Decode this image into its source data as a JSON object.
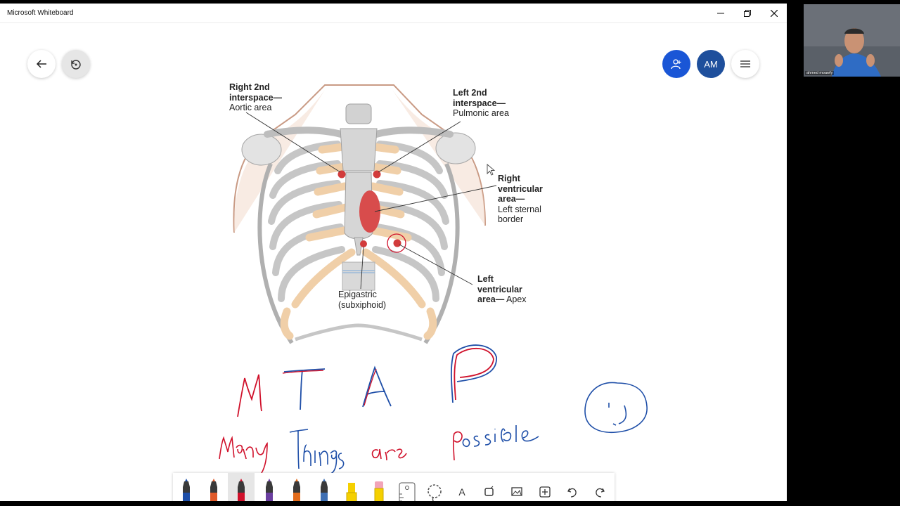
{
  "window": {
    "title": "Microsoft Whiteboard",
    "controls": [
      "minimize",
      "restore",
      "close"
    ]
  },
  "top_left_buttons": [
    {
      "icon": "back-arrow-icon"
    },
    {
      "icon": "undo-history-icon"
    }
  ],
  "top_right_buttons": {
    "invite_icon": "add-person-icon",
    "user_initials": "AM",
    "menu_icon": "hamburger-icon"
  },
  "diagram": {
    "labels": {
      "right_2nd_bold": "Right 2nd interspace—",
      "right_2nd_sub": "Aortic area",
      "left_2nd_bold": "Left 2nd interspace—",
      "left_2nd_sub": "Pulmonic area",
      "right_vent_bold": "Right ventricular area—",
      "right_vent_sub": "Left sternal border",
      "left_vent_bold": "Left ventricular area—",
      "left_vent_sub": "Apex",
      "epigastric_1": "Epigastric",
      "epigastric_2": "(subxiphoid)"
    }
  },
  "handwriting": {
    "letters": [
      "M",
      "T",
      "A",
      "P"
    ],
    "phrase": [
      "Many",
      "Things",
      "are",
      "possible"
    ],
    "colors": {
      "red": "#d0112b",
      "blue": "#1f4fa8"
    }
  },
  "toolbar": {
    "tools": [
      {
        "name": "pen-blue",
        "color": "#1f4fa8"
      },
      {
        "name": "pen-rainbow",
        "color": "#e05a2a"
      },
      {
        "name": "pen-red",
        "color": "#d0112b",
        "active": true
      },
      {
        "name": "pen-galaxy",
        "color": "#6b3fa0"
      },
      {
        "name": "pen-orange",
        "color": "#e36c1c"
      },
      {
        "name": "pen-teal",
        "color": "#3f6fb2"
      },
      {
        "name": "highlighter-yellow",
        "color": "#f5d000"
      },
      {
        "name": "eraser",
        "color": "#f2a4b8"
      },
      {
        "name": "ruler",
        "color": "#555"
      },
      {
        "name": "lasso",
        "color": "#555"
      },
      {
        "name": "text-tool",
        "glyph": "A"
      },
      {
        "name": "shape-tool"
      },
      {
        "name": "image-tool"
      },
      {
        "name": "insert-tool"
      },
      {
        "name": "undo-tool"
      },
      {
        "name": "redo-tool"
      }
    ]
  },
  "webcam": {
    "name": "ahmed moawfy"
  }
}
